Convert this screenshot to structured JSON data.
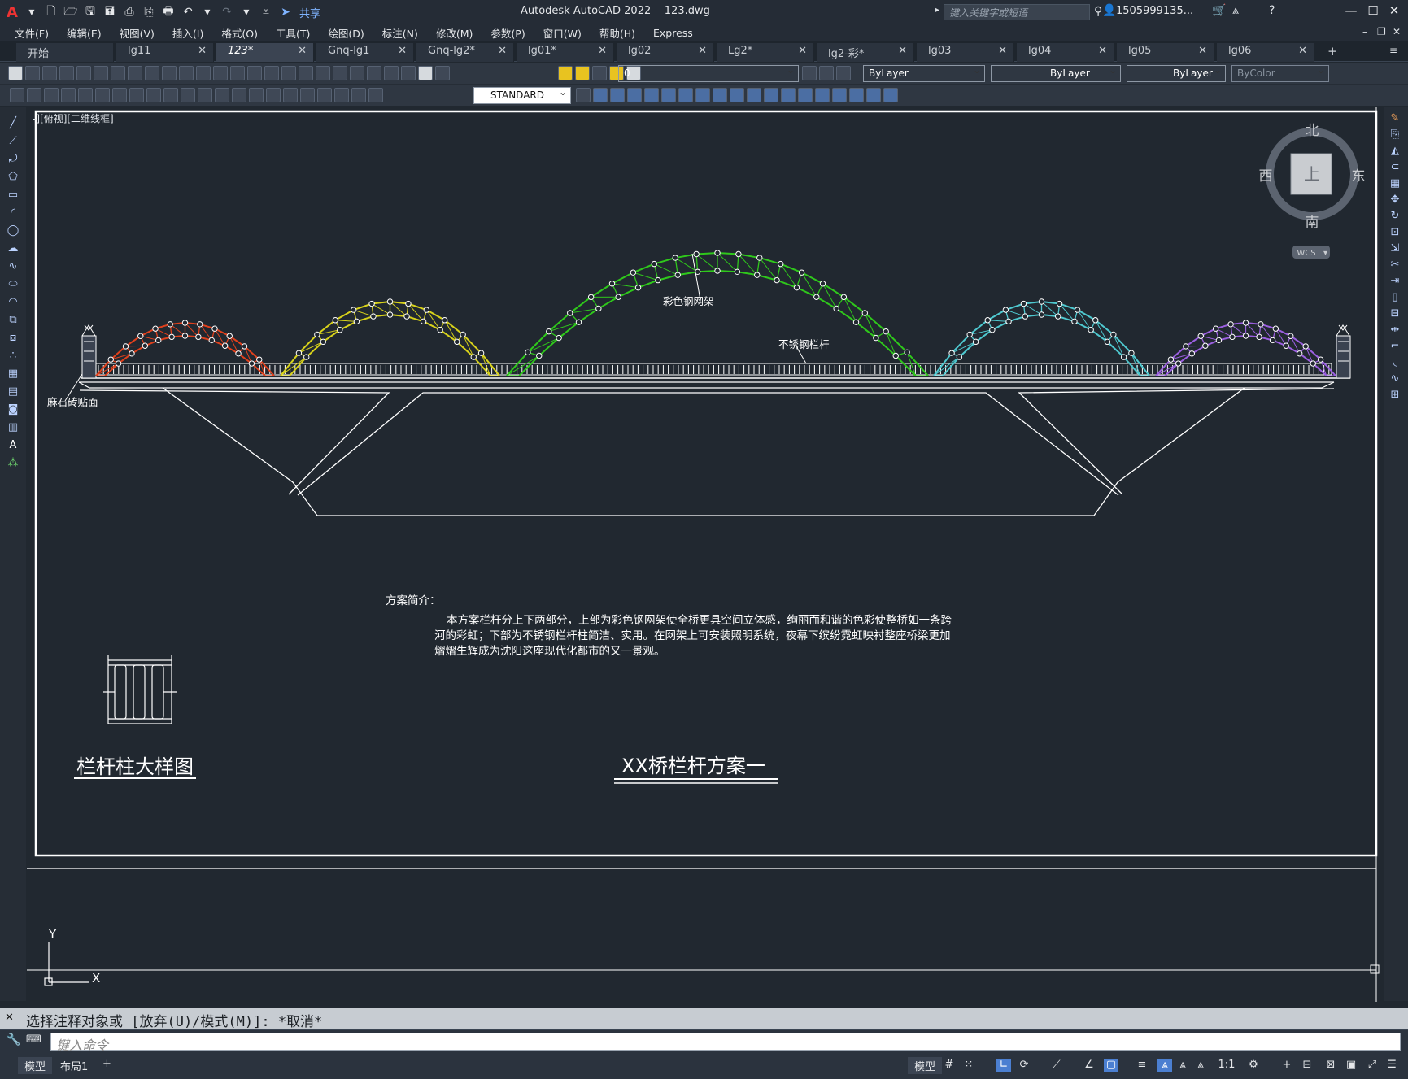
{
  "app": {
    "title": "Autodesk AutoCAD 2022    123.dwg",
    "share_label": "共享",
    "search_placeholder": "键入关键字或短语",
    "user": "1505999135...",
    "logo": "A"
  },
  "menus": [
    "文件(F)",
    "编辑(E)",
    "视图(V)",
    "插入(I)",
    "格式(O)",
    "工具(T)",
    "绘图(D)",
    "标注(N)",
    "修改(M)",
    "参数(P)",
    "窗口(W)",
    "帮助(H)",
    "Express"
  ],
  "tabs": [
    {
      "label": "开始",
      "close": ""
    },
    {
      "label": "lg11",
      "close": "✕"
    },
    {
      "label": "123*",
      "close": "✕",
      "active": true
    },
    {
      "label": "Gnq-lg1",
      "close": "✕"
    },
    {
      "label": "Gnq-lg2*",
      "close": "✕"
    },
    {
      "label": "lg01*",
      "close": "✕"
    },
    {
      "label": "lg02",
      "close": "✕"
    },
    {
      "label": "Lg2*",
      "close": "✕"
    },
    {
      "label": "lg2-彩*",
      "close": "✕"
    },
    {
      "label": "lg03",
      "close": "✕"
    },
    {
      "label": "lg04",
      "close": "✕"
    },
    {
      "label": "lg05",
      "close": "✕"
    },
    {
      "label": "lg06",
      "close": "✕"
    }
  ],
  "toolbar": {
    "layer_value": "0",
    "color_value": "ByLayer",
    "linetype_value": "ByLayer",
    "lineweight_value": "ByLayer",
    "plotstyle_value": "ByColor",
    "textstyle_value": "STANDARD"
  },
  "viewport": {
    "label": "-][俯视][二维线框]",
    "compass": {
      "north": "北",
      "south": "南",
      "east": "东",
      "west": "西",
      "top": "上",
      "wcs": "WCS"
    },
    "ucs_y": "Y",
    "ucs_x": "X"
  },
  "drawing": {
    "label_color_frame": "彩色钢网架",
    "label_stainless": "不锈钢栏杆",
    "label_stone": "麻石砖贴面",
    "intro_title": "方案简介：",
    "intro_lines": [
      "本方案栏杆分上下两部分，上部为彩色钢网架使全桥更具空间立体感，绚丽而和谐的色彩使整桥如一条跨",
      "河的彩虹；下部为不锈钢栏杆柱简洁、实用。在网架上可安装照明系统，夜幕下缤纷霓虹映衬整座桥梁更加",
      "熠熠生辉成为沈阳这座现代化都市的又一景观。"
    ],
    "detail_title": "栏杆柱大样图",
    "main_title": "XX桥栏杆方案一",
    "arch_colors": [
      "#e0401c",
      "#d8d21a",
      "#2fc81b",
      "#4ec8cf",
      "#9b5fe0"
    ]
  },
  "command": {
    "history": "选择注释对象或 [放弃(U)/模式(M)]: *取消*",
    "placeholder": "键入命令"
  },
  "status": {
    "tabs": [
      "模型",
      "布局1"
    ],
    "add": "+",
    "scale": "1:1"
  }
}
